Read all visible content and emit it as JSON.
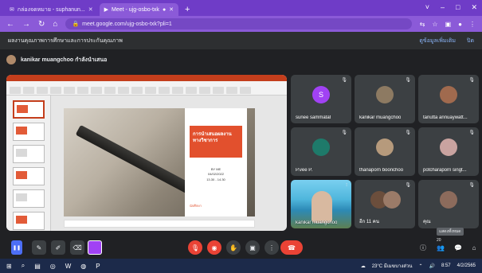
{
  "browser": {
    "tabs": [
      {
        "title": "กล่องจดหมาย - suphanun...",
        "active": false
      },
      {
        "title": "Meet - ujg-osbo-txk",
        "active": true
      }
    ],
    "url": "meet.google.com/ujg-osbo-txk?pli=1",
    "window_controls": [
      "–",
      "□",
      "✕"
    ]
  },
  "banner": {
    "text": "ผลงานคุณภาพการศึกษาและการประกันคุณภาพ",
    "link": "ดูข้อมูลเพิ่มเติม",
    "dismiss": "ปิด"
  },
  "presenter": {
    "label": "kanikar muangchoo กำลังนำเสนอ"
  },
  "slide": {
    "title": "การนำเสนอผลงานทางวิชาการ",
    "meta": [
      "BY ME",
      "04/02/2022",
      "13.30 - 14.30"
    ],
    "footer": "นักศึกษา"
  },
  "participants": [
    {
      "name": "sunee sammatat",
      "initial": "S",
      "color": "#a142f4"
    },
    {
      "name": "kanikar muangchoo",
      "initial": "",
      "color": "#8d7a62"
    },
    {
      "name": "tanutta annuaywatt...",
      "initial": "",
      "color": "#a06a4e"
    },
    {
      "name": "P.vee P.",
      "initial": "",
      "color": "#1e7a6a"
    },
    {
      "name": "thanaporn boonchoo",
      "initial": "",
      "color": "#b69a7c"
    },
    {
      "name": "potcharaporn singt...",
      "initial": "",
      "color": "#c9a3a0"
    },
    {
      "name": "kanikar muangchoo",
      "initial": "",
      "video": true
    },
    {
      "name": "อีก 11 คน",
      "initial": "",
      "color": "#6b4e3c"
    },
    {
      "name": "คุณ",
      "initial": "",
      "color": "#8c6b5c"
    }
  ],
  "toolbar": {
    "participant_count": "20",
    "tooltip": "แสดงทั้งหมด"
  },
  "taskbar": {
    "weather": "23°C มีเมฆบางส่วน",
    "time": "8:57",
    "date": "4/2/2565"
  }
}
